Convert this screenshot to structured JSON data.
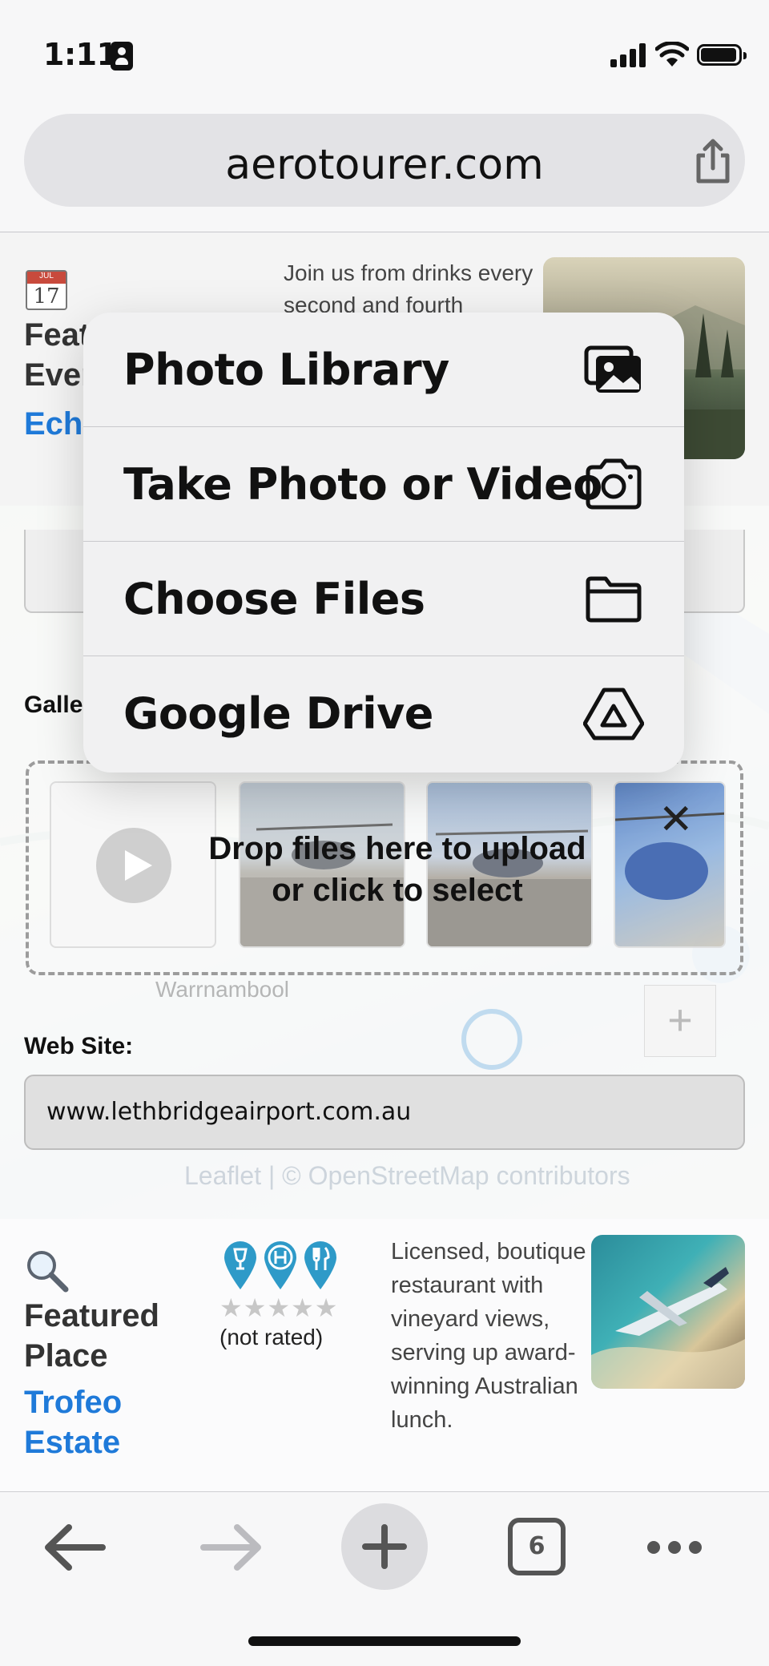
{
  "status_bar": {
    "time": "1:11"
  },
  "browser": {
    "url": "aerotourer.com",
    "tab_count": "6"
  },
  "featured_event": {
    "calendar_month": "JUL",
    "calendar_day": "17",
    "title": "Featured Event",
    "link": "Echuca",
    "description": "Join us from drinks every second and fourth"
  },
  "form": {
    "gallery_label": "Gallery:",
    "drop_text": "Drop files here to upload or click to select",
    "close_symbol": "✕",
    "website_label": "Web Site:",
    "website_value": "www.lethbridgeairport.com.au",
    "zoom_in": "+"
  },
  "map": {
    "town_label": "Warrnambool",
    "attribution": "Leaflet | © OpenStreetMap contributors"
  },
  "featured_place": {
    "title": "Featured Place",
    "link": "Trofeo Estate",
    "stars": "★★★★★",
    "rating_text": "(not rated)",
    "description": "Licensed, boutique restaurant with vineyard views, serving up award-winning Australian lunch."
  },
  "popup_menu": {
    "items": [
      {
        "label": "Photo Library",
        "icon": "photo-library-icon"
      },
      {
        "label": "Take Photo or Video",
        "icon": "camera-icon"
      },
      {
        "label": "Choose Files",
        "icon": "folder-icon"
      },
      {
        "label": "Google Drive",
        "icon": "google-drive-icon"
      }
    ]
  },
  "colors": {
    "link_blue": "#1f7ad9",
    "pin_teal": "#2e9ac8"
  }
}
